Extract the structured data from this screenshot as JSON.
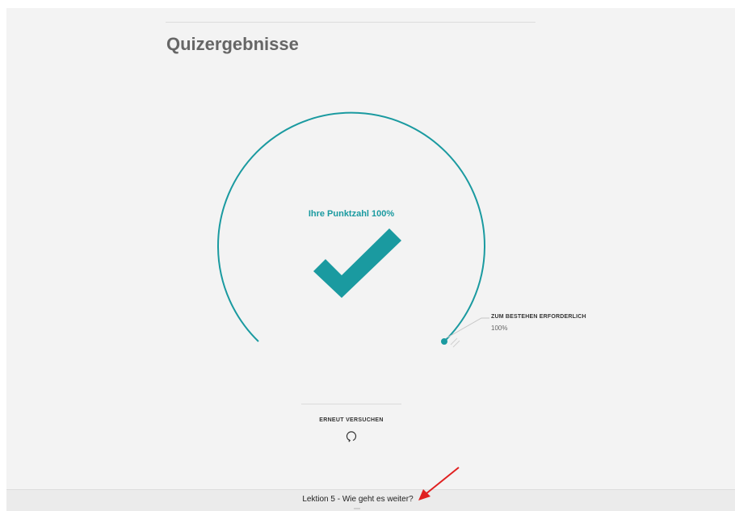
{
  "page": {
    "title": "Quizergebnisse"
  },
  "result": {
    "score_label": "Ihre Punktzahl 100%",
    "score_percent": 100,
    "status_icon": "checkmark-icon"
  },
  "requirement": {
    "label": "ZUM BESTEHEN ERFORDERLICH",
    "value": "100%"
  },
  "retry": {
    "label": "ERNEUT VERSUCHEN",
    "icon": "retry-icon"
  },
  "next_lesson": {
    "label": "Lektion 5 - Wie geht es weiter?"
  },
  "colors": {
    "accent": "#1a9aa0",
    "annotation_arrow": "#e02020",
    "background": "#f3f3f3"
  }
}
